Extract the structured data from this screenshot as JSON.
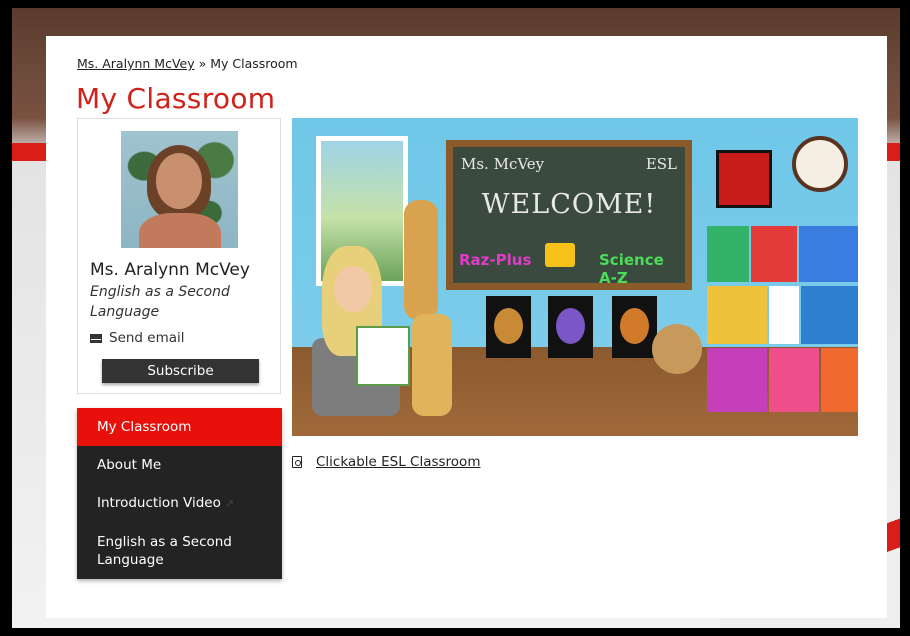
{
  "breadcrumb": {
    "parent": "Ms. Aralynn McVey",
    "separator": " » ",
    "current": "My Classroom"
  },
  "page_title": "My Classroom",
  "profile": {
    "name": "Ms. Aralynn McVey",
    "role": "English as a Second Language",
    "email_label": "Send email",
    "subscribe_label": "Subscribe"
  },
  "nav": {
    "items": [
      {
        "label": "My Classroom",
        "active": true
      },
      {
        "label": "About Me",
        "active": false
      },
      {
        "label": "Introduction Video",
        "active": false
      },
      {
        "label": "English as a Second Language",
        "active": false
      }
    ]
  },
  "banner": {
    "board_left": "Ms. McVey",
    "board_right": "ESL",
    "board_welcome": "WELCOME!",
    "board_raz": "Raz-Plus",
    "board_science": "Science A-Z"
  },
  "attachment": {
    "label": "Clickable ESL Classroom",
    "icon": "pdf-icon"
  },
  "colors": {
    "accent": "#e8100a",
    "title": "#d0211b",
    "nav_bg": "#232323"
  }
}
